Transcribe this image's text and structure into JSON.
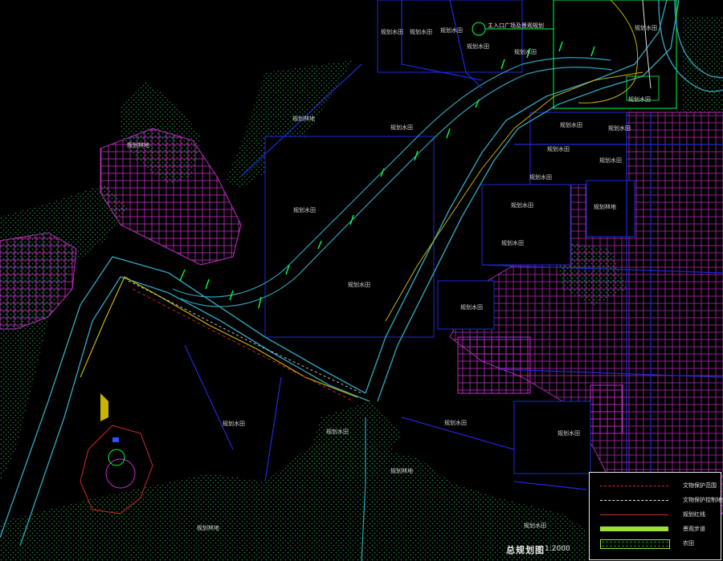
{
  "drawing": {
    "title": "总规划图",
    "scale": "1:2000",
    "callout": "主入口广场及景观规划"
  },
  "colors": {
    "background": "#000000",
    "settlement": "#c02cc0",
    "boundary": "#2fa0b8",
    "road": "#1c2ad8",
    "farmland_hatch": "#1f8a3a",
    "trail": "#c8b400",
    "highlight": "#00ff40",
    "legend_green": "#9be235"
  },
  "map_labels": [
    "规划水田",
    "规划水田",
    "规划水田",
    "规划水田",
    "规划水田",
    "规划水田",
    "规划水田",
    "规划水田",
    "规划林地",
    "规划林地",
    "规划水田",
    "规划水田",
    "规划水田",
    "规划水田",
    "规划水田",
    "规划水田",
    "规划林地",
    "规划水田",
    "规划水田",
    "规划水田",
    "规划水田",
    "规划水田",
    "规划水田",
    "规划林地",
    "规划林地",
    "规划水田",
    "规划水田",
    "规划水田"
  ],
  "legend": {
    "items": [
      {
        "symbol": "red-dashed-line",
        "label": "文物保护范围"
      },
      {
        "symbol": "white-dashed-line",
        "label": "文物保护控制地带"
      },
      {
        "symbol": "red-solid-line",
        "label": "规划红线"
      },
      {
        "symbol": "green-bar",
        "label": "景观步道"
      },
      {
        "symbol": "dotted-box",
        "label": "农田"
      }
    ]
  }
}
